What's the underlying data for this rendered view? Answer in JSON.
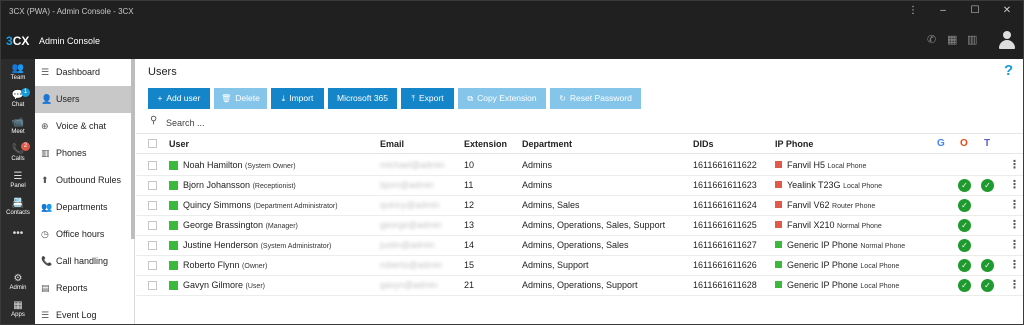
{
  "window": {
    "title": "3CX (PWA) - Admin Console - 3CX"
  },
  "app": {
    "logo_prefix": "3",
    "logo_suffix": "CX",
    "title": "Admin Console"
  },
  "rail": [
    {
      "label": "Team",
      "icon": "👥"
    },
    {
      "label": "Chat",
      "icon": "💬",
      "badge": "1",
      "badge_color": "#1a9ad6"
    },
    {
      "label": "Meet",
      "icon": "📹"
    },
    {
      "label": "Calls",
      "icon": "📞",
      "badge": "2",
      "badge_color": "#e05a4a"
    },
    {
      "label": "Panel",
      "icon": "☰"
    },
    {
      "label": "Contacts",
      "icon": "📇"
    },
    {
      "label": "",
      "icon": "•••"
    },
    {
      "label": "Admin",
      "icon": "⚙"
    },
    {
      "label": "Apps",
      "icon": "▦"
    }
  ],
  "nav": [
    {
      "label": "Dashboard",
      "icon": "☰"
    },
    {
      "label": "Users",
      "icon": "👤",
      "active": true
    },
    {
      "label": "Voice & chat",
      "icon": "⊕"
    },
    {
      "label": "Phones",
      "icon": "▥"
    },
    {
      "label": "Outbound Rules",
      "icon": "⬆"
    },
    {
      "label": "Departments",
      "icon": "👥"
    },
    {
      "label": "Office hours",
      "icon": "◷"
    },
    {
      "label": "Call handling",
      "icon": "📞"
    },
    {
      "label": "Reports",
      "icon": "▤"
    },
    {
      "label": "Event Log",
      "icon": "☰"
    }
  ],
  "page": {
    "title": "Users",
    "help": "?"
  },
  "toolbar": {
    "add_user": "Add user",
    "delete": "Delete",
    "import": "Import",
    "microsoft365": "Microsoft 365",
    "export": "Export",
    "copy_extension": "Copy Extension",
    "reset_password": "Reset Password"
  },
  "search": {
    "placeholder": "Search ..."
  },
  "table": {
    "headers": {
      "user": "User",
      "email": "Email",
      "extension": "Extension",
      "department": "Department",
      "dids": "DIDs",
      "ip_phone": "IP Phone"
    },
    "rows": [
      {
        "name": "Noah Hamilton",
        "role": "(System Owner)",
        "email": "michael@admin",
        "ext": "10",
        "dept": "Admins",
        "did": "1611661611622",
        "phone": "Fanvil H5",
        "model": "Local Phone",
        "phone_color": "#e05a4a",
        "ms": false,
        "teams": false
      },
      {
        "name": "Bjorn Johansson",
        "role": "(Receptionist)",
        "email": "bjorn@admin",
        "ext": "11",
        "dept": "Admins",
        "did": "1611661611623",
        "phone": "Yealink T23G",
        "model": "Local Phone",
        "phone_color": "#e05a4a",
        "ms": true,
        "teams": true
      },
      {
        "name": "Quincy Simmons",
        "role": "(Department Administrator)",
        "email": "quincy@admin",
        "ext": "12",
        "dept": "Admins, Sales",
        "did": "1611661611624",
        "phone": "Fanvil V62",
        "model": "Router Phone",
        "phone_color": "#e05a4a",
        "ms": true,
        "teams": false
      },
      {
        "name": "George Brassington",
        "role": "(Manager)",
        "email": "george@admin",
        "ext": "13",
        "dept": "Admins, Operations, Sales, Support",
        "did": "1611661611625",
        "phone": "Fanvil X210",
        "model": "Normal Phone",
        "phone_color": "#e05a4a",
        "ms": true,
        "teams": false
      },
      {
        "name": "Justine Henderson",
        "role": "(System Administrator)",
        "email": "justin@admin",
        "ext": "14",
        "dept": "Admins, Operations, Sales",
        "did": "1611661611627",
        "phone": "Generic IP Phone",
        "model": "Normal Phone",
        "phone_color": "#3cb93c",
        "ms": true,
        "teams": false
      },
      {
        "name": "Roberto Flynn",
        "role": "(Owner)",
        "email": "roberto@admin",
        "ext": "15",
        "dept": "Admins, Support",
        "did": "1611661611626",
        "phone": "Generic IP Phone",
        "model": "Local Phone",
        "phone_color": "#3cb93c",
        "ms": true,
        "teams": true
      },
      {
        "name": "Gavyn Gilmore",
        "role": "(User)",
        "email": "gavyn@admin",
        "ext": "21",
        "dept": "Admins, Operations, Support",
        "did": "1611661611628",
        "phone": "Generic IP Phone",
        "model": "Local Phone",
        "phone_color": "#3cb93c",
        "ms": true,
        "teams": true
      }
    ]
  },
  "colors": {
    "accent": "#1585c9",
    "accent_light": "#86c5ea",
    "status_green": "#3cb93c",
    "check_green": "#1f9a2f",
    "phone_red": "#e05a4a"
  },
  "icons": {
    "google": "G",
    "office": "O",
    "teams": "T",
    "kebab": "⋮",
    "search": "⚲",
    "check": "✓"
  }
}
